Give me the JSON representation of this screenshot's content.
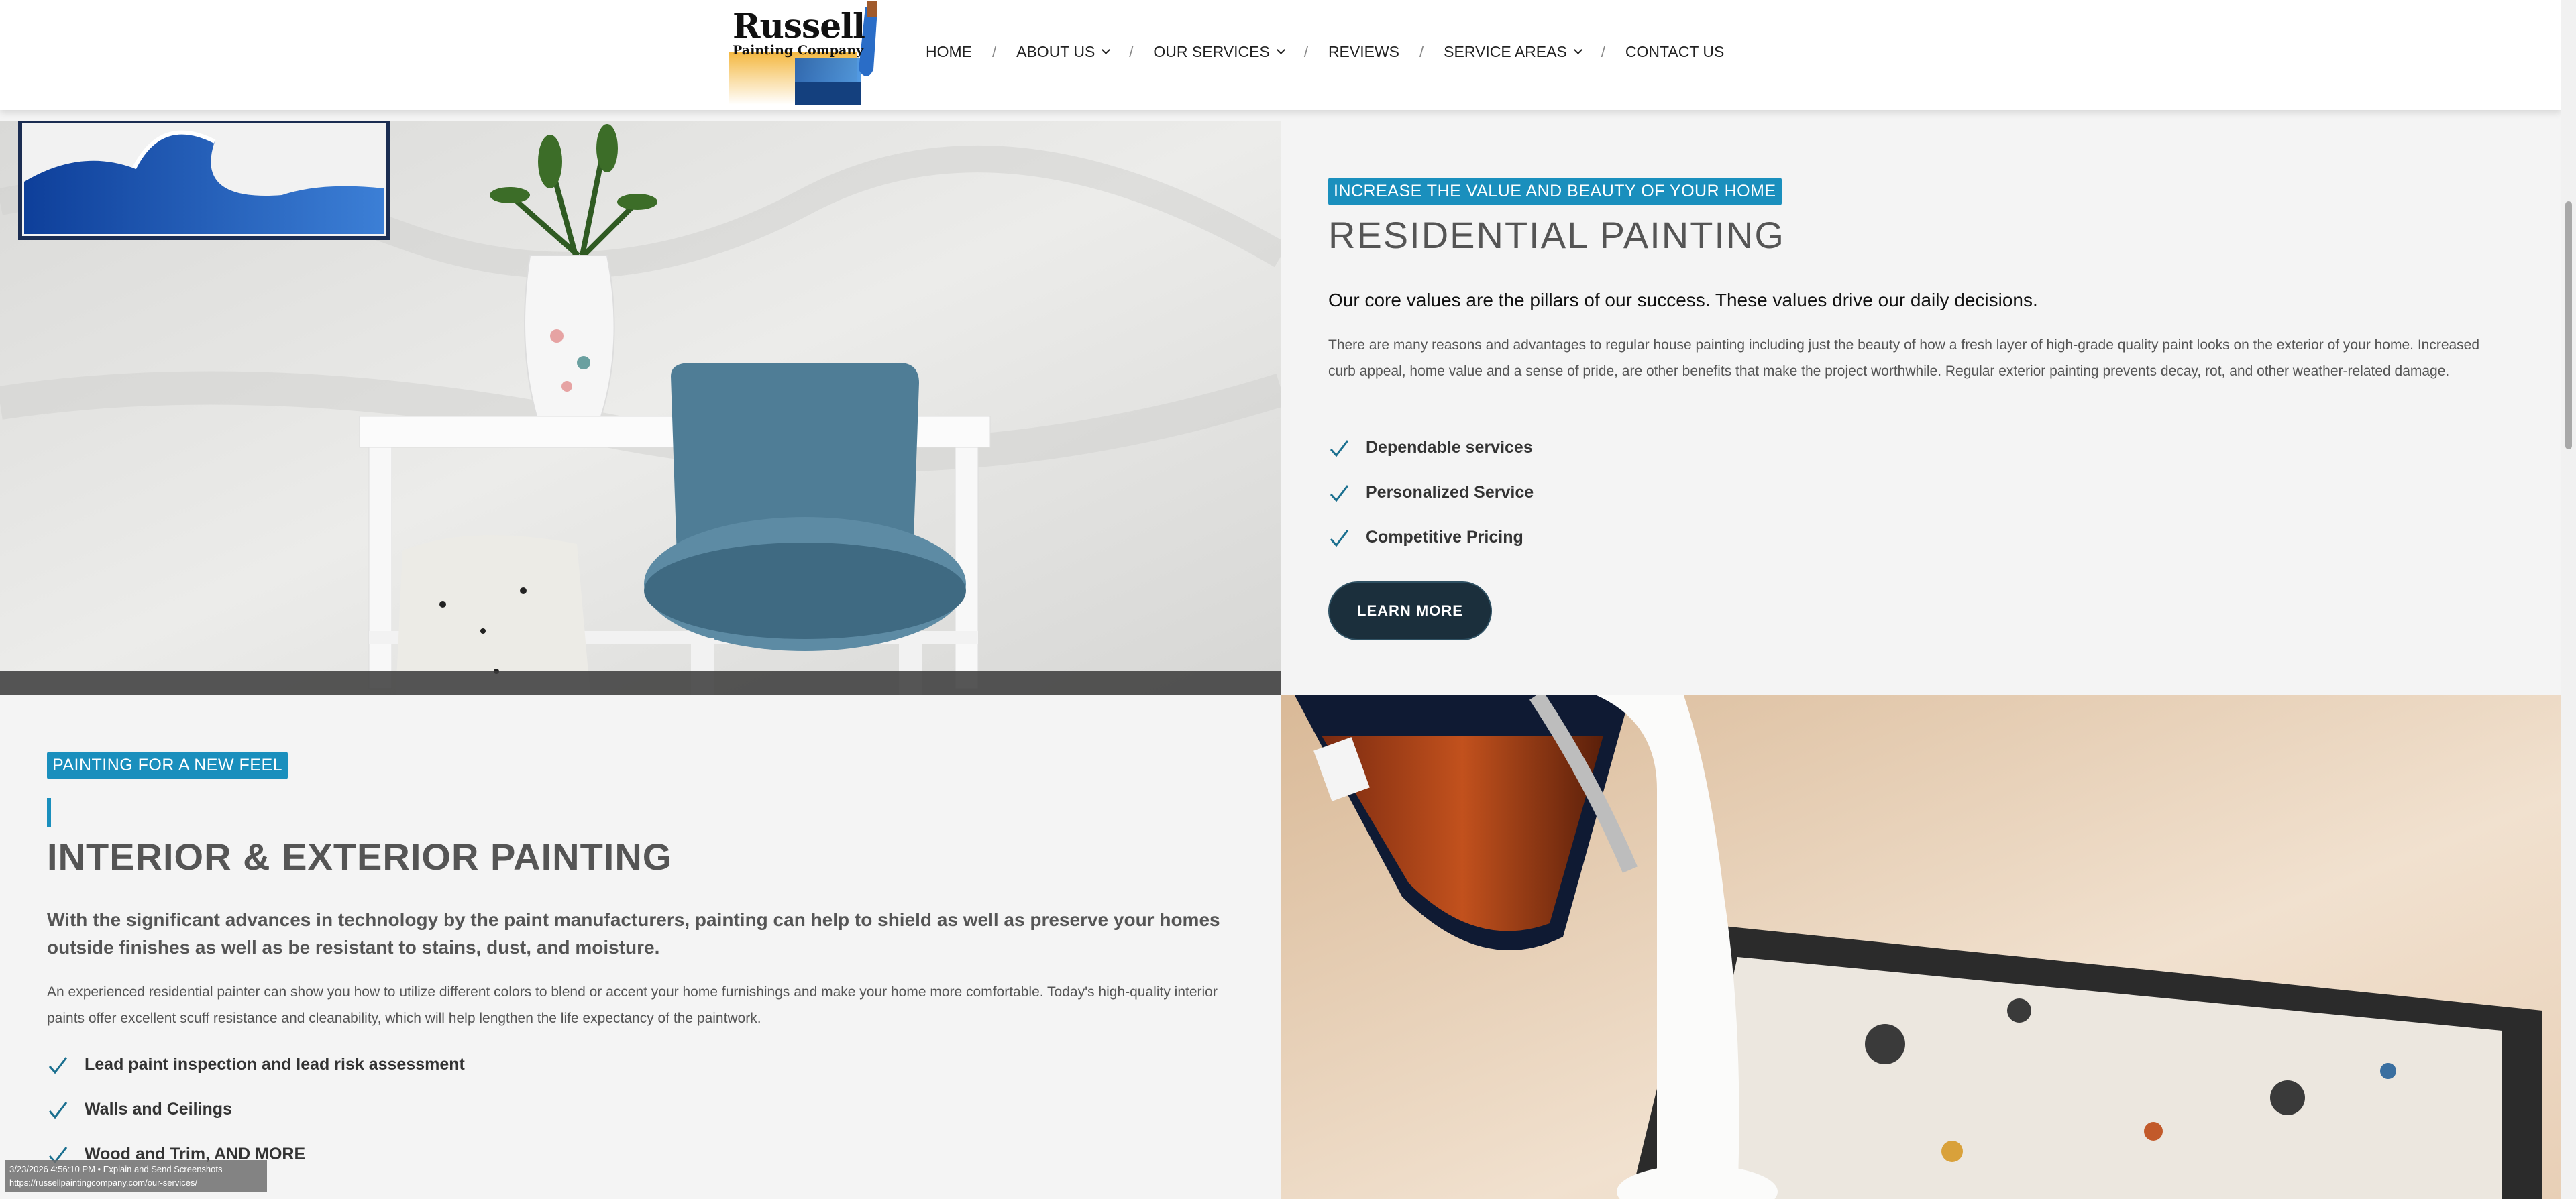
{
  "header": {
    "logo": {
      "name": "Russell",
      "subtitle": "Painting Company"
    },
    "nav": [
      {
        "label": "HOME",
        "dropdown": false
      },
      {
        "label": "ABOUT US",
        "dropdown": true
      },
      {
        "label": "OUR SERVICES",
        "dropdown": true
      },
      {
        "label": "REVIEWS",
        "dropdown": false
      },
      {
        "label": "SERVICE AREAS",
        "dropdown": true
      },
      {
        "label": "CONTACT US",
        "dropdown": false
      }
    ],
    "separator": "/"
  },
  "residential": {
    "eyebrow": "INCREASE THE VALUE AND BEAUTY OF YOUR HOME",
    "title": "RESIDENTIAL PAINTING",
    "lead": "Our core values are the pillars of our success. These values drive our daily decisions.",
    "body": "There are many reasons and advantages to regular house painting including just the beauty of how a fresh layer of high-grade quality paint looks on the exterior of your home. Increased curb appeal, home value and a sense of pride, are other benefits that make the project worthwhile. Regular exterior painting prevents decay, rot, and other weather-related damage.",
    "features": [
      "Dependable services",
      "Personalized Service",
      "Competitive Pricing"
    ],
    "button": "LEARN MORE"
  },
  "interior": {
    "eyebrow": "PAINTING FOR A NEW FEEL",
    "title": "INTERIOR & EXTERIOR PAINTING",
    "lead": "With the significant advances in technology by the paint manufacturers, painting can help to shield as well as preserve your homes outside finishes as well as be resistant to stains, dust, and moisture.",
    "body": " An experienced residential painter can show you how to utilize different colors to blend or accent your home furnishings and make your home more comfortable. Today's high-quality interior paints offer excellent scuff resistance and cleanability, which will help lengthen the life expectancy of the paintwork.",
    "features": [
      "Lead paint inspection and lead risk assessment",
      "Walls and Ceilings",
      "Wood and Trim, AND MORE"
    ]
  },
  "status_overlay": {
    "line1": "3/23/2026 4:56:10 PM • Explain and Send Screenshots",
    "line2": "https://russellpaintingcompany.com/our-services/"
  },
  "colors": {
    "accent": "#1a8fbd",
    "button": "#1b2f3c",
    "check": "#1a6f8f"
  },
  "icons": [
    "checkmark-icon",
    "chevron-down-icon",
    "paintbrush-logo-icon"
  ]
}
